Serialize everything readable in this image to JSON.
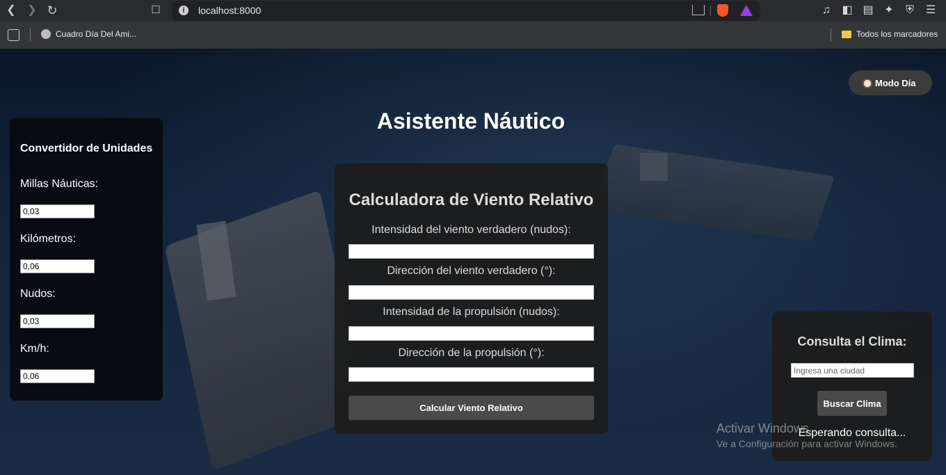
{
  "browser": {
    "url": "localhost:8000",
    "bookmarks": [
      {
        "label": "Cuadro Día Del Ami..."
      }
    ],
    "all_bookmarks_label": "Todos los marcadores"
  },
  "page": {
    "mode_button_label": "Modo Día",
    "title": "Asistente Náutico",
    "converter": {
      "title": "Convertidor de Unidades",
      "fields": [
        {
          "label": "Millas Náuticas:",
          "value": "0,03"
        },
        {
          "label": "Kilómetros:",
          "value": "0,06"
        },
        {
          "label": "Nudos:",
          "value": "0,03"
        },
        {
          "label": "Km/h:",
          "value": "0,06"
        }
      ]
    },
    "calculator": {
      "title": "Calculadora de Viento Relativo",
      "fields": [
        {
          "label": "Intensidad del viento verdadero (nudos):",
          "value": ""
        },
        {
          "label": "Dirección del viento verdadero (°):",
          "value": ""
        },
        {
          "label": "Intensidad de la propulsión (nudos):",
          "value": ""
        },
        {
          "label": "Dirección de la propulsión (°):",
          "value": ""
        }
      ],
      "button_label": "Calcular Viento Relativo"
    },
    "weather": {
      "title": "Consulta el Clima:",
      "input_placeholder": "Ingresa una ciudad",
      "button_label": "Buscar Clima",
      "status": "Esperando consulta..."
    }
  },
  "watermark": {
    "line1": "Activar Windows",
    "line2": "Ve a Configuración para activar Windows."
  }
}
